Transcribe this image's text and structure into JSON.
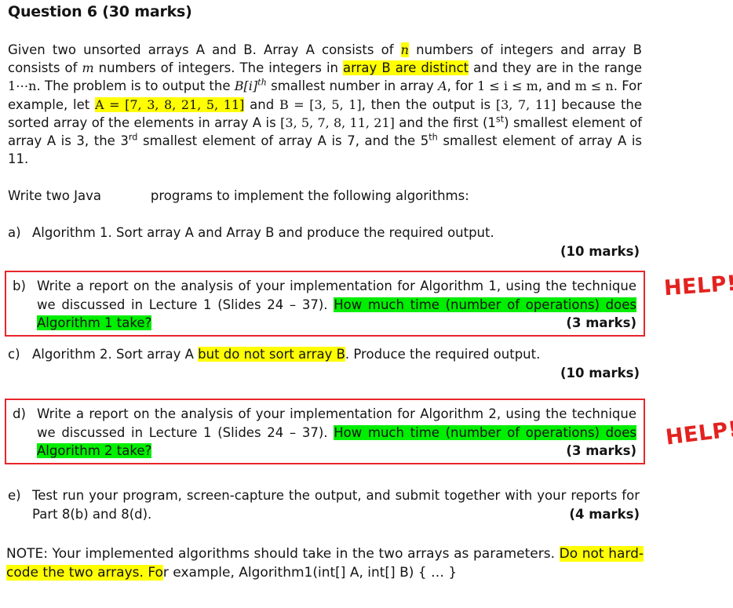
{
  "document": {
    "title": "Question 6 (30 marks)",
    "intro": {
      "seg1": "Given two unsorted arrays A and B. Array A consists of ",
      "hl_n": "n",
      "seg2": " numbers of integers and array B consists of ",
      "m1": "m",
      "seg3": " numbers of integers. The integers in ",
      "hl_distinct": "array B are distinct",
      "seg4": " and they are in the range ",
      "range": "1⋯n",
      "seg5": ". The problem is to output the ",
      "bith_base": "B[i]",
      "bith_sup": "th",
      "seg6": " smallest number in array ",
      "aital": "A",
      "seg7": ", for ",
      "cond1": "1 ≤ i ≤ m",
      "seg8": ", and ",
      "cond2": "m ≤ n",
      "seg9": ". For example, let ",
      "hl_arrayA": "A = [7, 3, 8, 21, 5, 11]",
      "seg10": " and ",
      "arrayB": "B = [3, 5, 1]",
      "seg11": ", then the output is ",
      "output": "[3, 7, 11]",
      "seg12": " because the sorted array of the elements in array A is ",
      "sorted": "[3, 5, 7, 8, 11, 21]",
      "seg13": " and the first (1",
      "sup_st": "st",
      "seg14": ") smallest element of array A is 3, the 3",
      "sup_rd": "rd",
      "seg15": " smallest element of array A is 7, and the 5",
      "sup_th": "th",
      "seg16": " smallest element of array A is 11."
    },
    "write_java": "Write two Java            programs to implement the following algorithms:",
    "items": [
      {
        "label": "a)",
        "text": "Algorithm 1. Sort array A and Array B and produce the required output.",
        "marks": "(10 marks)"
      },
      {
        "label": "b)",
        "text_before": "Write a report on the analysis of your implementation for Algorithm 1, using the technique we discussed in Lecture 1 (Slides 24 – 37). ",
        "highlight": "How much time (number of operations) does Algorithm 1 take?",
        "marks": "(3 marks)",
        "boxed": true,
        "annotation": "HELP!"
      },
      {
        "label": "c)",
        "text_before": "Algorithm 2. Sort array A ",
        "highlight": "but do not sort array B",
        "text_after": ". Produce the required output.",
        "marks": "(10 marks)"
      },
      {
        "label": "d)",
        "text_before": "Write a report on the analysis of your implementation for Algorithm 2, using the technique we discussed in Lecture 1 (Slides 24 – 37). ",
        "highlight": "How much time (number of operations) does Algorithm 2 take?",
        "marks": "(3 marks)",
        "boxed": true,
        "annotation": "HELP!"
      },
      {
        "label": "e)",
        "text": "Test run your program, screen-capture the output, and submit together with your reports for Part 8(b) and 8(d).",
        "marks": "(4 marks)"
      }
    ],
    "note": {
      "seg1": "NOTE: Your implemented algorithms should take in the two arrays as parameters. ",
      "highlight": "Do not hard-code the two arrays. Fo",
      "seg2": "r example, Algorithm1(int[] A, int[] B) { … }"
    },
    "colors": {
      "highlight_yellow": "#ffff00",
      "highlight_green": "#00ee00",
      "annotation_red": "#e3221f",
      "box_red": "#e8262b",
      "text": "#141414",
      "background": "#ffffff"
    }
  }
}
